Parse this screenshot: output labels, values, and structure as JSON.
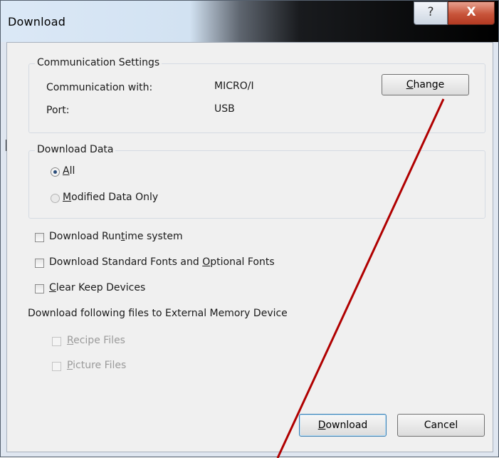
{
  "window": {
    "title": "Download",
    "help_glyph": "?",
    "close_glyph": "X"
  },
  "communication": {
    "group_title": "Communication Settings",
    "comm_with_label": "Communication with:",
    "comm_with_value": "MICRO/I",
    "port_label": "Port:",
    "port_value": "USB",
    "change_button": {
      "mnemonic": "C",
      "rest": "hange"
    }
  },
  "download_data": {
    "group_title": "Download Data",
    "options": [
      {
        "mnemonic": "A",
        "rest": "ll",
        "selected": true
      },
      {
        "mnemonic": "M",
        "rest": "odified Data Only",
        "selected": false
      }
    ]
  },
  "options": {
    "runtime": {
      "pre": "Download Run",
      "mnemonic": "t",
      "post": "ime system",
      "checked": false
    },
    "fonts": {
      "pre": "Download Standard Fonts and ",
      "mnemonic": "O",
      "post": "ptional Fonts",
      "checked": false
    },
    "clear_keep": {
      "pre": "",
      "mnemonic": "C",
      "post": "lear Keep Devices",
      "checked": false
    }
  },
  "external_memory": {
    "label": "Download following files to External Memory Device",
    "items": [
      {
        "mnemonic": "R",
        "rest": "ecipe Files",
        "checked": false,
        "enabled": false
      },
      {
        "mnemonic": "P",
        "rest": "icture Files",
        "checked": false,
        "enabled": false
      }
    ]
  },
  "buttons": {
    "download": {
      "mnemonic": "D",
      "rest": "ownload"
    },
    "cancel": "Cancel"
  },
  "colors": {
    "annotation_line": "#b00000",
    "close_button": "#c8543a"
  }
}
